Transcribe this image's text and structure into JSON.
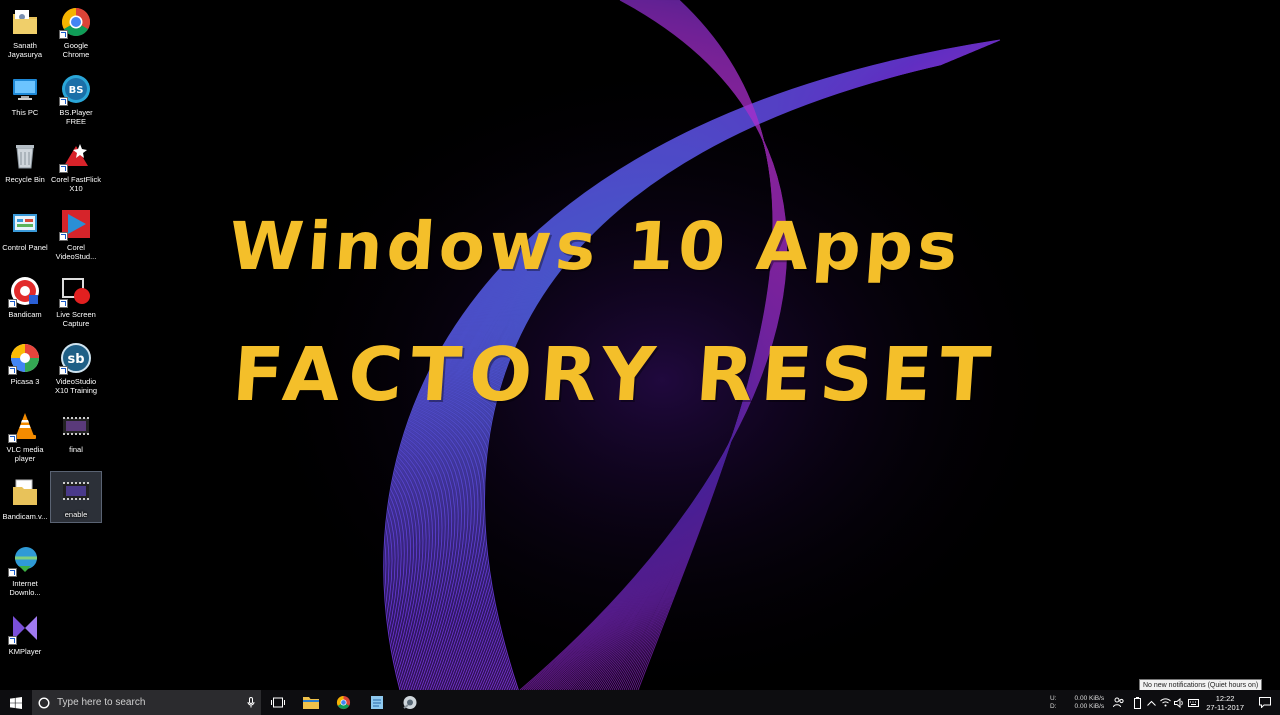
{
  "overlay_title": {
    "line1": "Windows 10 Apps",
    "line2": "FACTORY RESET",
    "color": "#f4bf2a"
  },
  "desktop_icons": [
    {
      "label": "Sanath Jayasurya",
      "icon": "user-folder-icon"
    },
    {
      "label": "Google Chrome",
      "icon": "chrome-icon"
    },
    {
      "label": "This PC",
      "icon": "computer-icon"
    },
    {
      "label": "BS.Player FREE",
      "icon": "bsplayer-icon"
    },
    {
      "label": "Recycle Bin",
      "icon": "recycle-bin-icon"
    },
    {
      "label": "Corel FastFlick X10",
      "icon": "corel-fastflick-icon"
    },
    {
      "label": "Control Panel",
      "icon": "control-panel-icon"
    },
    {
      "label": "Corel VideoStud...",
      "icon": "corel-videostudio-icon"
    },
    {
      "label": "Bandicam",
      "icon": "bandicam-icon"
    },
    {
      "label": "Live Screen Capture",
      "icon": "screen-capture-icon"
    },
    {
      "label": "Picasa 3",
      "icon": "picasa-icon"
    },
    {
      "label": "VideoStudio X10 Training",
      "icon": "videostudio-training-icon"
    },
    {
      "label": "VLC media player",
      "icon": "vlc-icon"
    },
    {
      "label": "final",
      "icon": "video-file-icon"
    },
    {
      "label": "Bandicam.v...",
      "icon": "folder-icon"
    },
    {
      "label": "enable",
      "icon": "video-file-icon"
    },
    {
      "label": "Internet Downlo...",
      "icon": "idm-icon"
    },
    {
      "label": "KMPlayer",
      "icon": "kmplayer-icon"
    }
  ],
  "taskbar": {
    "search_placeholder": "Type here to search",
    "apps": [
      "task-view-icon",
      "file-explorer-icon",
      "chrome-icon",
      "notepad-icon",
      "media-player-icon"
    ],
    "net_upload_label": "U:",
    "net_download_label": "D:",
    "net_upload_speed": "0.00 KiB/s",
    "net_download_speed": "0.00 KiB/s",
    "time": "12:22",
    "date": "27-11-2017",
    "notification_tooltip": "No new notifications (Quiet hours on)"
  },
  "colors": {
    "wallpaper_blue": "#2a7bd8",
    "wallpaper_purple": "#7a2fd0",
    "wallpaper_magenta": "#d018c8",
    "taskbar": "#0d0d10"
  }
}
